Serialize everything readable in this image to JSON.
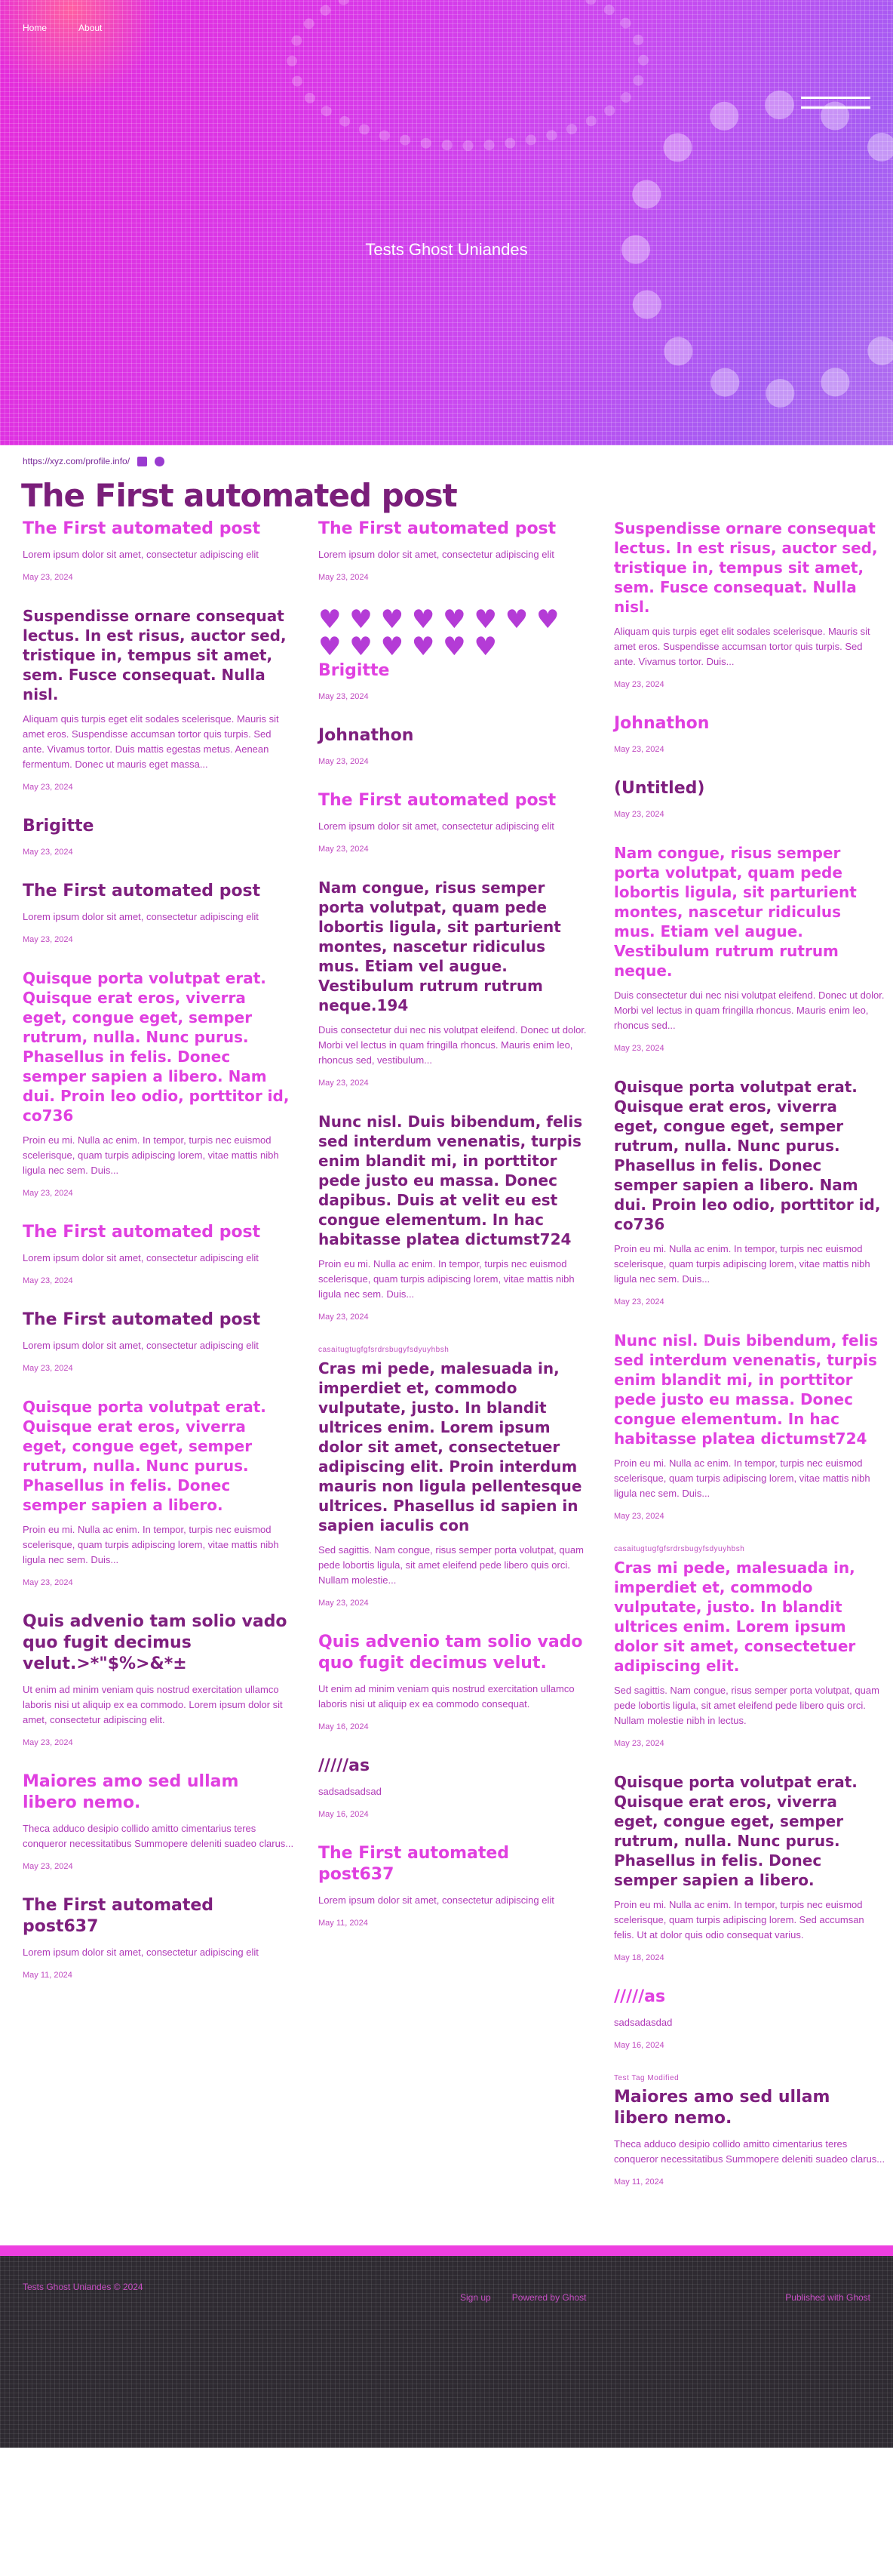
{
  "nav": {
    "item1": "Home",
    "item2": "About"
  },
  "hero": {
    "site_title": "Tests Ghost Uniandes"
  },
  "author": {
    "website": "https://xyz.com/profile.info/"
  },
  "colors": {
    "accent": "#e040e0",
    "title": "#7e1f7e",
    "footer_bg": "#2e2a31"
  },
  "feed_title": "The First automated post",
  "columns": [
    [
      {
        "title": "The First automated post",
        "excerpt": "Lorem ipsum dolor sit amet, consectetur adipiscing elit",
        "date": "May 23, 2024",
        "pink": true
      },
      {
        "title": "Suspendisse ornare consequat lectus. In est risus, auctor sed, tristique in, tempus sit amet, sem. Fusce consequat. Nulla nisl.",
        "excerpt": "Aliquam quis turpis eget elit sodales scelerisque. Mauris sit amet eros. Suspendisse accumsan tortor quis turpis. Sed ante. Vivamus tortor. Duis mattis egestas metus. Aenean fermentum. Donec ut mauris eget massa...",
        "date": "May 23, 2024"
      },
      {
        "title": "Brigitte",
        "excerpt": "",
        "date": "May 23, 2024"
      },
      {
        "title": "The First automated post",
        "excerpt": "Lorem ipsum dolor sit amet, consectetur adipiscing elit",
        "date": "May 23, 2024"
      },
      {
        "title": "Quisque porta volutpat erat. Quisque erat eros, viverra eget, congue eget, semper rutrum, nulla. Nunc purus. Phasellus in felis. Donec semper sapien a libero. Nam dui. Proin leo odio, porttitor id, co736",
        "excerpt": "Proin eu mi. Nulla ac enim. In tempor, turpis nec euismod scelerisque, quam turpis adipiscing lorem, vitae mattis nibh ligula nec sem. Duis...",
        "date": "May 23, 2024",
        "pink": true
      },
      {
        "title": "The First automated post",
        "excerpt": "Lorem ipsum dolor sit amet, consectetur adipiscing elit",
        "date": "May 23, 2024",
        "pink": true
      },
      {
        "title": "The First automated post",
        "excerpt": "Lorem ipsum dolor sit amet, consectetur adipiscing elit",
        "date": "May 23, 2024"
      },
      {
        "title": "Quisque porta volutpat erat. Quisque erat eros, viverra eget, congue eget, semper rutrum, nulla. Nunc purus. Phasellus in felis. Donec semper sapien a libero.",
        "excerpt": "Proin eu mi. Nulla ac enim. In tempor, turpis nec euismod scelerisque, quam turpis adipiscing lorem, vitae mattis nibh ligula nec sem. Duis...",
        "date": "May 23, 2024",
        "pink": true
      },
      {
        "title": "Quis advenio tam solio vado quo fugit decimus velut.>*\"$%>&*±",
        "excerpt": "Ut enim ad minim veniam quis nostrud exercitation ullamco laboris nisi ut aliquip ex ea commodo. Lorem ipsum dolor sit amet, consectetur adipiscing elit.",
        "date": "May 23, 2024"
      },
      {
        "title": "Maiores amo sed ullam libero nemo.",
        "excerpt": "Theca adduco desipio collido amitto cimentarius teres conqueror necessitatibus Summopere deleniti suadeo clarus...",
        "date": "May 23, 2024",
        "pink": true
      },
      {
        "title": "The First automated post637",
        "excerpt": "Lorem ipsum dolor sit amet, consectetur adipiscing elit",
        "date": "May 11, 2024"
      }
    ],
    [
      {
        "title": "The First automated post",
        "excerpt": "Lorem ipsum dolor sit amet, consectetur adipiscing elit",
        "date": "May 23, 2024",
        "pink": true
      },
      {
        "hearts": "♥ ♥ ♥ ♥ ♥ ♥ ♥ ♥ ♥ ♥ ♥ ♥ ♥ ♥",
        "title": "Brigitte",
        "excerpt": "",
        "date": "May 23, 2024",
        "pink": true
      },
      {
        "title": "Johnathon",
        "excerpt": "",
        "date": "May 23, 2024"
      },
      {
        "title": "The First automated post",
        "excerpt": "Lorem ipsum dolor sit amet, consectetur adipiscing elit",
        "date": "May 23, 2024",
        "pink": true
      },
      {
        "title": "Nam congue, risus semper porta volutpat, quam pede lobortis ligula, sit parturient montes, nascetur ridiculus mus. Etiam vel augue. Vestibulum rutrum rutrum neque.194",
        "excerpt": "Duis consectetur dui nec nis volutpat eleifend. Donec ut dolor. Morbi vel lectus in quam fringilla rhoncus. Mauris enim leo, rhoncus sed, vestibulum...",
        "date": "May 23, 2024"
      },
      {
        "title": "Nunc nisl. Duis bibendum, felis sed interdum venenatis, turpis enim blandit mi, in porttitor pede justo eu massa. Donec dapibus. Duis at velit eu est congue elementum. In hac habitasse platea dictumst724",
        "excerpt": "Proin eu mi. Nulla ac enim. In tempor, turpis nec euismod scelerisque, quam turpis adipiscing lorem, vitae mattis nibh ligula nec sem. Duis...",
        "date": "May 23, 2024"
      },
      {
        "tag": "casaitugtugfgfsrdrsbugyfsdyuyhbsh",
        "title": "Cras mi pede, malesuada in, imperdiet et, commodo vulputate, justo. In blandit ultrices enim. Lorem ipsum dolor sit amet, consectetuer adipiscing elit. Proin interdum mauris non ligula pellentesque ultrices. Phasellus id sapien in sapien iaculis con",
        "excerpt": "Sed sagittis. Nam congue, risus semper porta volutpat, quam pede lobortis ligula, sit amet eleifend pede libero quis orci. Nullam molestie...",
        "date": "May 23, 2024"
      },
      {
        "title": "Quis advenio tam solio vado quo fugit decimus velut.",
        "excerpt": "Ut enim ad minim veniam quis nostrud exercitation ullamco laboris nisi ut aliquip ex ea commodo consequat.",
        "date": "May 16, 2024",
        "pink": true
      },
      {
        "title": "/////as",
        "excerpt": "sadsadsadsad",
        "date": "May 16, 2024"
      },
      {
        "title": "The First automated post637",
        "excerpt": "Lorem ipsum dolor sit amet, consectetur adipiscing elit",
        "date": "May 11, 2024",
        "pink": true
      }
    ],
    [
      {
        "title": "Suspendisse ornare consequat lectus. In est risus, auctor sed, tristique in, tempus sit amet, sem. Fusce consequat. Nulla nisl.",
        "excerpt": "Aliquam quis turpis eget elit sodales scelerisque. Mauris sit amet eros. Suspendisse accumsan tortor quis turpis. Sed ante. Vivamus tortor. Duis...",
        "date": "May 23, 2024",
        "pink": true
      },
      {
        "title": "Johnathon",
        "excerpt": "",
        "date": "May 23, 2024",
        "pink": true
      },
      {
        "title": "(Untitled)",
        "excerpt": "",
        "date": "May 23, 2024"
      },
      {
        "title": "Nam congue, risus semper porta volutpat, quam pede lobortis ligula, sit parturient montes, nascetur ridiculus mus. Etiam vel augue. Vestibulum rutrum rutrum neque.",
        "excerpt": "Duis consectetur dui nec nisi volutpat eleifend. Donec ut dolor. Morbi vel lectus in quam fringilla rhoncus. Mauris enim leo, rhoncus sed...",
        "date": "May 23, 2024",
        "pink": true
      },
      {
        "title": "Quisque porta volutpat erat. Quisque erat eros, viverra eget, congue eget, semper rutrum, nulla. Nunc purus. Phasellus in felis. Donec semper sapien a libero. Nam dui. Proin leo odio, porttitor id, co736",
        "excerpt": "Proin eu mi. Nulla ac enim. In tempor, turpis nec euismod scelerisque, quam turpis adipiscing lorem, vitae mattis nibh ligula nec sem. Duis...",
        "date": "May 23, 2024"
      },
      {
        "title": "Nunc nisl. Duis bibendum, felis sed interdum venenatis, turpis enim blandit mi, in porttitor pede justo eu massa. Donec congue elementum. In hac habitasse platea dictumst724",
        "excerpt": "Proin eu mi. Nulla ac enim. In tempor, turpis nec euismod scelerisque, quam turpis adipiscing lorem, vitae mattis nibh ligula nec sem. Duis...",
        "date": "May 23, 2024",
        "pink": true
      },
      {
        "tag": "casaitugtugfgfsrdrsbugyfsdyuyhbsh",
        "title": "Cras mi pede, malesuada in, imperdiet et, commodo vulputate, justo. In blandit ultrices enim. Lorem ipsum dolor sit amet, consectetuer adipiscing elit.",
        "excerpt": "Sed sagittis. Nam congue, risus semper porta volutpat, quam pede lobortis ligula, sit amet eleifend pede libero quis orci. Nullam molestie nibh in lectus.",
        "date": "May 23, 2024",
        "pink": true
      },
      {
        "title": "Quisque porta volutpat erat. Quisque erat eros, viverra eget, congue eget, semper rutrum, nulla. Nunc purus. Phasellus in felis. Donec semper sapien a libero.",
        "excerpt": "Proin eu mi. Nulla ac enim. In tempor, turpis nec euismod scelerisque, quam turpis adipiscing lorem. Sed accumsan felis. Ut at dolor quis odio consequat varius.",
        "date": "May 18, 2024"
      },
      {
        "title": "/////as",
        "excerpt": "sadsadasdad",
        "date": "May 16, 2024",
        "pink": true
      },
      {
        "tag": "Test Tag Modified",
        "title": "Maiores amo sed ullam libero nemo.",
        "excerpt": "Theca adduco desipio collido amitto cimentarius teres conqueror necessitatibus Summopere deleniti suadeo clarus...",
        "date": "May 11, 2024"
      }
    ]
  ],
  "footer": {
    "left": "Tests Ghost Uniandes © 2024",
    "mid1": "Sign up",
    "mid2": "Powered by Ghost",
    "right": "Published with Ghost"
  }
}
